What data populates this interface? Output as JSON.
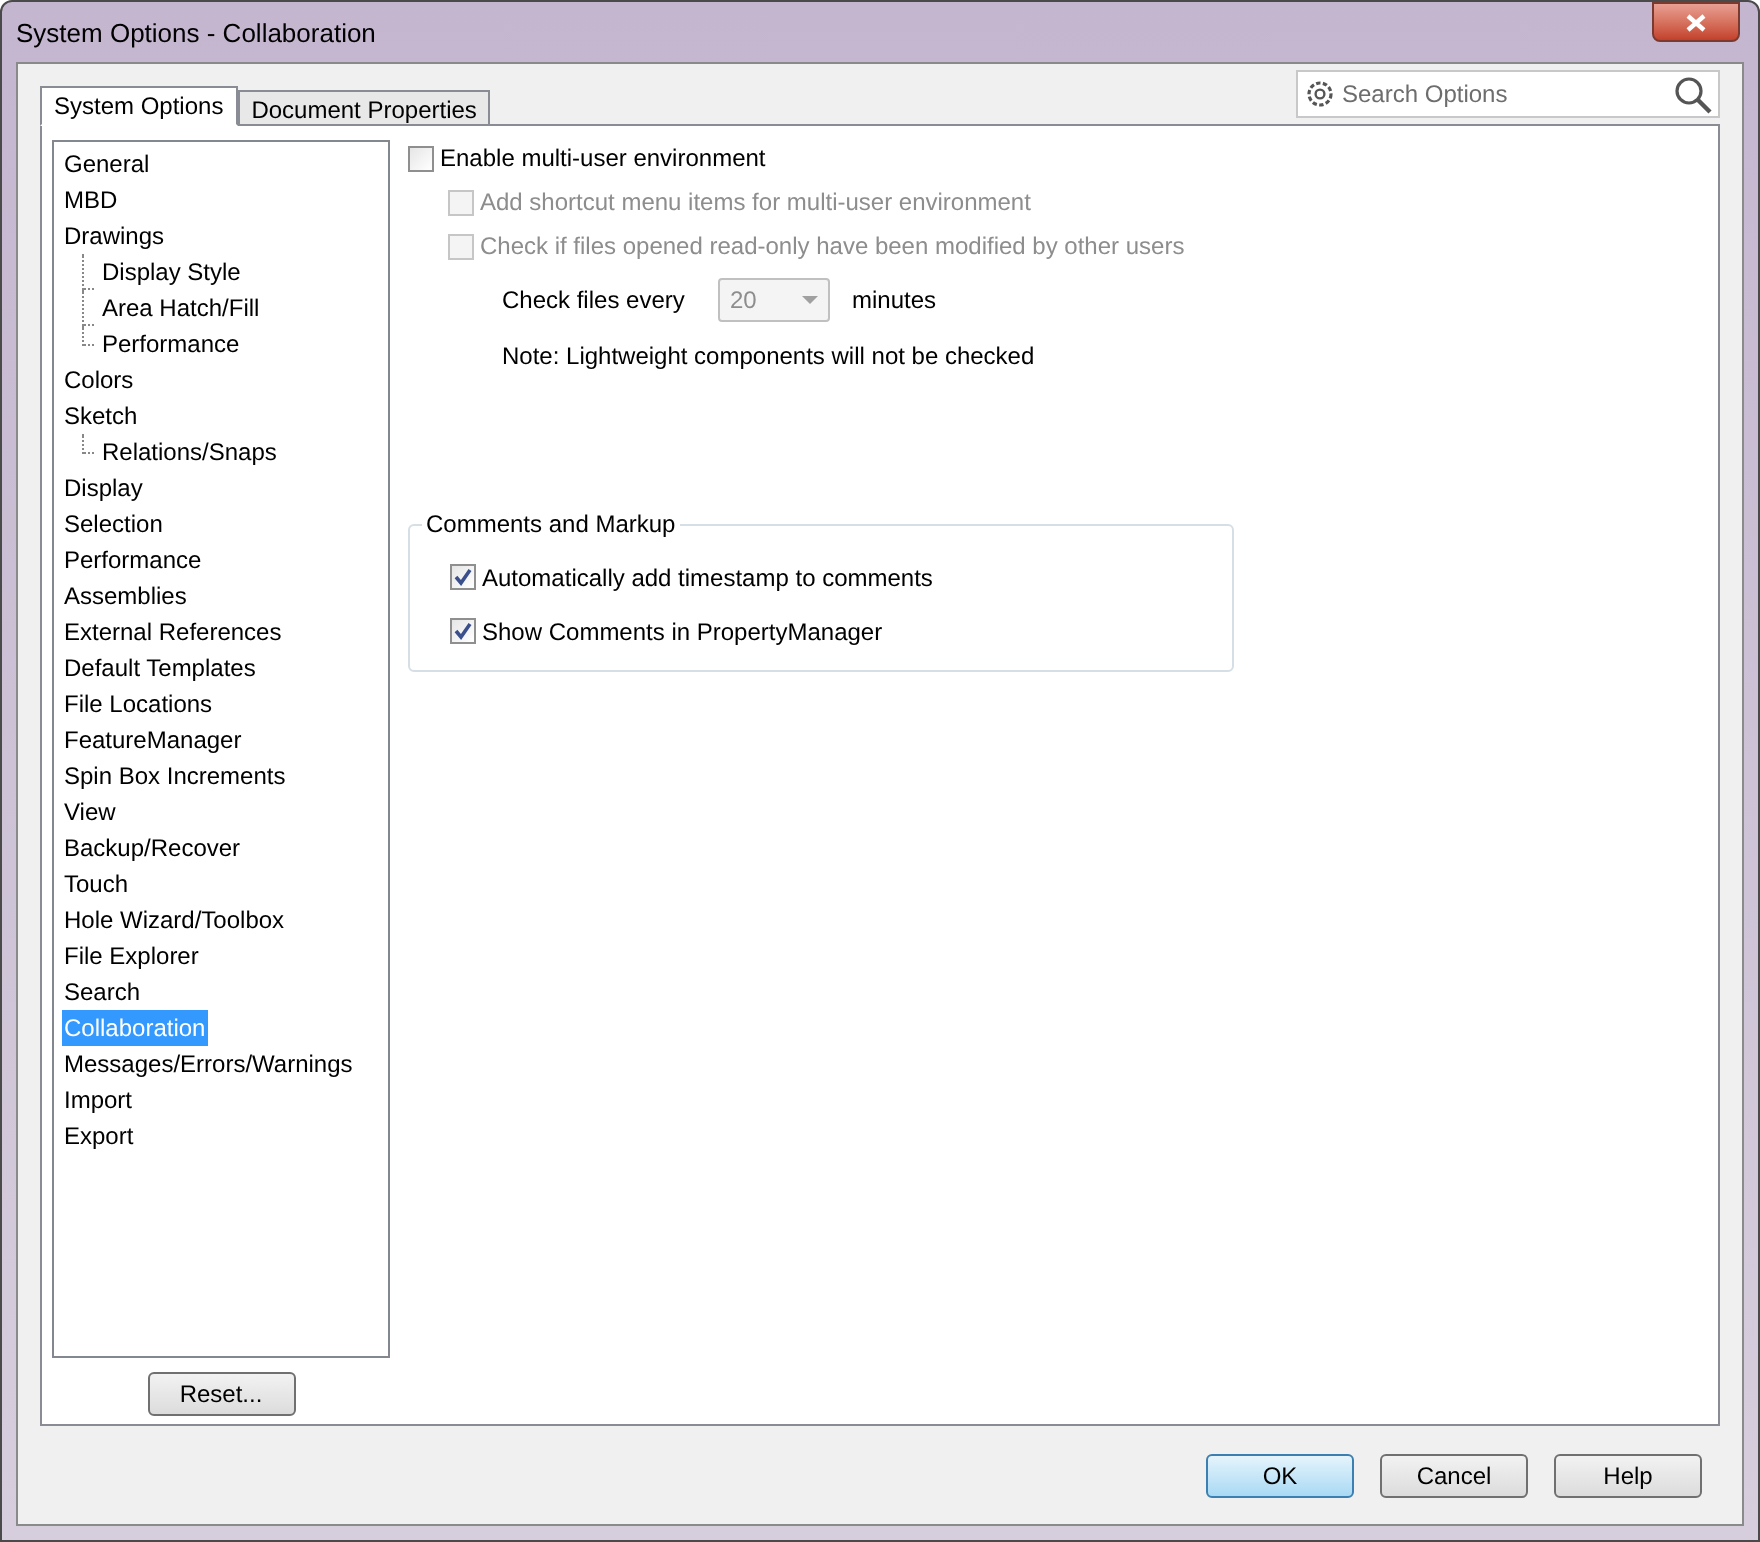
{
  "window": {
    "title": "System Options - Collaboration"
  },
  "tabs": [
    {
      "label": "System Options",
      "selected": true
    },
    {
      "label": "Document Properties",
      "selected": false
    }
  ],
  "search": {
    "placeholder": "Search Options"
  },
  "tree": [
    {
      "label": "General",
      "selected": false
    },
    {
      "label": "MBD",
      "selected": false
    },
    {
      "label": "Drawings",
      "selected": false,
      "children": [
        {
          "label": "Display Style",
          "selected": false
        },
        {
          "label": "Area Hatch/Fill",
          "selected": false
        },
        {
          "label": "Performance",
          "selected": false
        }
      ]
    },
    {
      "label": "Colors",
      "selected": false
    },
    {
      "label": "Sketch",
      "selected": false,
      "children": [
        {
          "label": "Relations/Snaps",
          "selected": false
        }
      ]
    },
    {
      "label": "Display",
      "selected": false
    },
    {
      "label": "Selection",
      "selected": false
    },
    {
      "label": "Performance",
      "selected": false
    },
    {
      "label": "Assemblies",
      "selected": false
    },
    {
      "label": "External References",
      "selected": false
    },
    {
      "label": "Default Templates",
      "selected": false
    },
    {
      "label": "File Locations",
      "selected": false
    },
    {
      "label": "FeatureManager",
      "selected": false
    },
    {
      "label": "Spin Box Increments",
      "selected": false
    },
    {
      "label": "View",
      "selected": false
    },
    {
      "label": "Backup/Recover",
      "selected": false
    },
    {
      "label": "Touch",
      "selected": false
    },
    {
      "label": "Hole Wizard/Toolbox",
      "selected": false
    },
    {
      "label": "File Explorer",
      "selected": false
    },
    {
      "label": "Search",
      "selected": false
    },
    {
      "label": "Collaboration",
      "selected": true
    },
    {
      "label": "Messages/Errors/Warnings",
      "selected": false
    },
    {
      "label": "Import",
      "selected": false
    },
    {
      "label": "Export",
      "selected": false
    }
  ],
  "reset_button": "Reset...",
  "options": [
    {
      "kind": "checkbox",
      "label": "Enable multi-user environment",
      "checked": false,
      "disabled": false,
      "children": [
        {
          "kind": "checkbox",
          "label": "Add shortcut menu items for multi-user environment",
          "checked": false,
          "disabled": true
        },
        {
          "kind": "checkbox",
          "label": "Check if files opened read-only have been modified by other users",
          "checked": false,
          "disabled": true,
          "children": [
            {
              "kind": "dropdown",
              "label": "Check files every",
              "value": "20",
              "unit": "minutes",
              "disabled": true
            },
            {
              "kind": "note",
              "label": "Note: Lightweight components will not be checked"
            }
          ]
        }
      ]
    }
  ],
  "group": {
    "title": "Comments and Markup",
    "items": [
      {
        "label": "Automatically add timestamp to comments",
        "checked": true,
        "disabled": false
      },
      {
        "label": "Show Comments in PropertyManager",
        "checked": true,
        "disabled": false
      }
    ]
  },
  "buttons": [
    {
      "label": "OK",
      "default": true
    },
    {
      "label": "Cancel",
      "default": false
    },
    {
      "label": "Help",
      "default": false
    }
  ]
}
